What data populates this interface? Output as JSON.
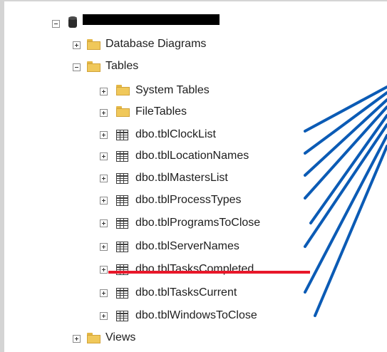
{
  "tree": {
    "root": {
      "label_redacted": true,
      "expanded": true
    },
    "database_diagrams": {
      "label": "Database Diagrams",
      "expanded": false
    },
    "tables": {
      "label": "Tables",
      "expanded": true
    },
    "system_tables": {
      "label": "System Tables"
    },
    "file_tables": {
      "label": "FileTables"
    },
    "table_items": [
      {
        "label": "dbo.tblClockList"
      },
      {
        "label": "dbo.tblLocationNames"
      },
      {
        "label": "dbo.tblMastersList"
      },
      {
        "label": "dbo.tblProcessTypes"
      },
      {
        "label": "dbo.tblProgramsToClose"
      },
      {
        "label": "dbo.tblServerNames"
      },
      {
        "label": "dbo.tblTasksCompleted",
        "struck_out": true
      },
      {
        "label": "dbo.tblTasksCurrent"
      },
      {
        "label": "dbo.tblWindowsToClose"
      }
    ],
    "views": {
      "label": "Views",
      "expanded": false
    }
  },
  "annotation": {
    "line_color": "#0b5bb5",
    "strike_color": "#e8182a"
  }
}
